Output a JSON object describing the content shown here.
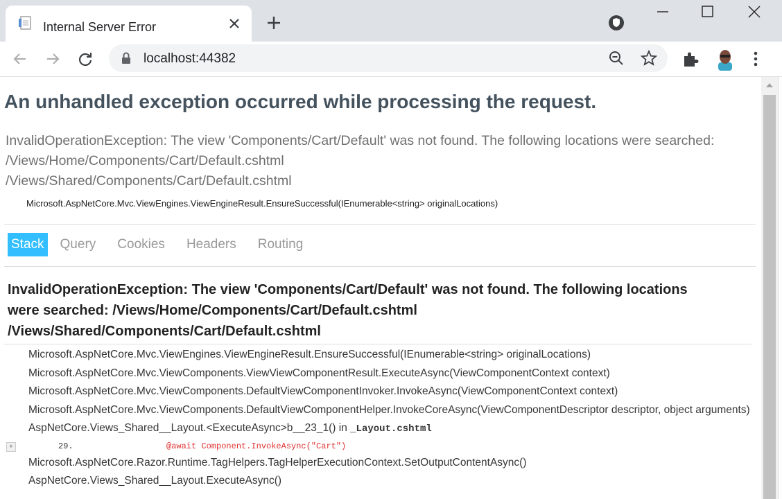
{
  "browser": {
    "tab_title": "Internal Server Error",
    "url": "localhost:44382"
  },
  "page": {
    "heading": "An unhandled exception occurred while processing the request.",
    "message_lines": [
      "InvalidOperationException: The view 'Components/Cart/Default' was not found. The following locations were searched:",
      "/Views/Home/Components/Cart/Default.cshtml",
      "/Views/Shared/Components/Cart/Default.cshtml"
    ],
    "location": "Microsoft.AspNetCore.Mvc.ViewEngines.ViewEngineResult.EnsureSuccessful(IEnumerable<string> originalLocations)",
    "tabs": [
      "Stack",
      "Query",
      "Cookies",
      "Headers",
      "Routing"
    ],
    "stack_heading_lines": [
      "InvalidOperationException: The view 'Components/Cart/Default' was not found. The following locations",
      "were searched: /Views/Home/Components/Cart/Default.cshtml",
      "/Views/Shared/Components/Cart/Default.cshtml"
    ],
    "frames": [
      "Microsoft.AspNetCore.Mvc.ViewEngines.ViewEngineResult.EnsureSuccessful(IEnumerable<string> originalLocations)",
      "Microsoft.AspNetCore.Mvc.ViewComponents.ViewViewComponentResult.ExecuteAsync(ViewComponentContext context)",
      "Microsoft.AspNetCore.Mvc.ViewComponents.DefaultViewComponentInvoker.InvokeAsync(ViewComponentContext context)",
      "Microsoft.AspNetCore.Mvc.ViewComponents.DefaultViewComponentHelper.InvokeCoreAsync(ViewComponentDescriptor descriptor, object arguments)",
      "AspNetCore.Views_Shared__Layout.<ExecuteAsync>b__23_1() in ",
      "Microsoft.AspNetCore.Razor.Runtime.TagHelpers.TagHelperExecutionContext.SetOutputContentAsync()",
      "AspNetCore.Views_Shared__Layout.ExecuteAsync()"
    ],
    "frame_file": "_Layout.cshtml",
    "code": {
      "expander": "+",
      "line_number": "29.",
      "code_text": "@await Component.InvokeAsync(\"Cart\")"
    }
  },
  "colors": {
    "active_tab": "#33bfff",
    "heading": "#44525e",
    "code_highlight": "#e03030"
  }
}
